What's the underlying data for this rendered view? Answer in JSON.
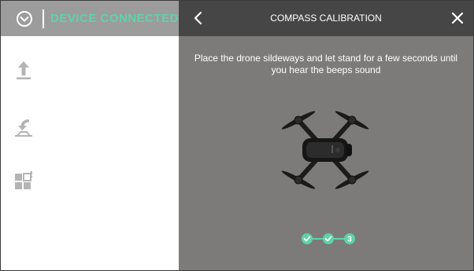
{
  "sidebar": {
    "menu_icon": "chevron-circle-icon",
    "device_status": "DEVICE CONNECTED",
    "items": [
      {
        "icon": "takeoff-icon"
      },
      {
        "icon": "return-home-icon"
      },
      {
        "icon": "widgets-icon"
      }
    ]
  },
  "dialog": {
    "title": "COMPASS CALIBRATION",
    "back_icon": "chevron-left-icon",
    "close_icon": "close-icon",
    "instruction": "Place the drone sildeways and let stand for a few seconds until you hear the beeps sound",
    "steps": {
      "completed": 2,
      "current_label": "3"
    }
  },
  "colors": {
    "accent": "#5fd3a8",
    "header_bg": "#474646",
    "panel_bg": "#7d7b7a",
    "left_header_bg": "#9c9c9c"
  }
}
